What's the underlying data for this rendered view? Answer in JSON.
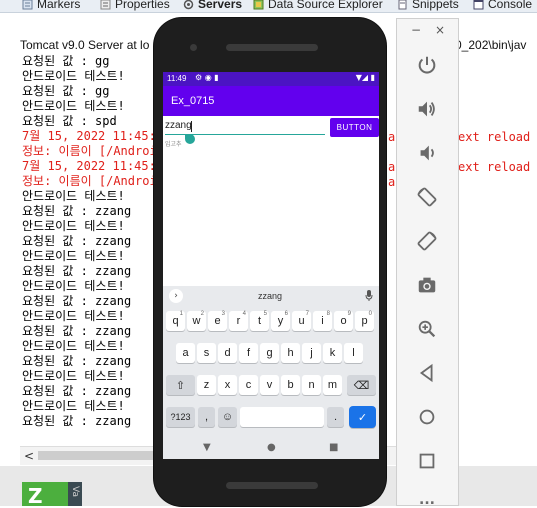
{
  "tabs": [
    {
      "label": "Markers",
      "icon": "markers-icon",
      "active": false
    },
    {
      "label": "Properties",
      "icon": "properties-icon",
      "active": false
    },
    {
      "label": "Servers",
      "icon": "servers-icon",
      "active": true
    },
    {
      "label": "Data Source Explorer",
      "icon": "data-source-icon",
      "active": false
    },
    {
      "label": "Snippets",
      "icon": "snippets-icon",
      "active": false
    },
    {
      "label": "Console",
      "icon": "console-icon",
      "active": false
    }
  ],
  "console": {
    "server_label": "Tomcat v9.0 Server at lo",
    "server_label_right": "0_202\\bin\\jav",
    "lines": [
      {
        "text": "요청된 값 : gg",
        "red": false
      },
      {
        "text": "안드로이드 테스트!",
        "red": false
      },
      {
        "text": "요청된 값 : gg",
        "red": false
      },
      {
        "text": "안드로이드 테스트!",
        "red": false
      },
      {
        "text": "요청된 값 : spd",
        "red": false
      },
      {
        "text": "7월 15, 2022 11:45:",
        "red": true
      },
      {
        "text": "정보: 이름이 [/Androi",
        "red": true
      },
      {
        "text": "7월 15, 2022 11:45:",
        "red": true
      },
      {
        "text": "정보: 이름이 [/Androi",
        "red": true
      },
      {
        "text": "안드로이드 테스트!",
        "red": false
      },
      {
        "text": "요청된 값 : zzang",
        "red": false
      },
      {
        "text": "안드로이드 테스트!",
        "red": false
      },
      {
        "text": "요청된 값 : zzang",
        "red": false
      },
      {
        "text": "안드로이드 테스트!",
        "red": false
      },
      {
        "text": "요청된 값 : zzang",
        "red": false
      },
      {
        "text": "안드로이드 테스트!",
        "red": false
      },
      {
        "text": "요청된 값 : zzang",
        "red": false
      },
      {
        "text": "안드로이드 테스트!",
        "red": false
      },
      {
        "text": "요청된 값 : zzang",
        "red": false
      },
      {
        "text": "안드로이드 테스트!",
        "red": false
      },
      {
        "text": "요청된 값 : zzang",
        "red": false
      },
      {
        "text": "안드로이드 테스트!",
        "red": false
      },
      {
        "text": "요청된 값 : zzang",
        "red": false
      },
      {
        "text": "안드로이드 테스트!",
        "red": false
      },
      {
        "text": "요청된 값 : zzang",
        "red": false
      }
    ],
    "red_fragments": [
      "a",
      "ext reload",
      "a",
      "ext reload",
      "a"
    ]
  },
  "phone": {
    "status_time": "11:49",
    "status_icons": "⚙ ◉ ▮",
    "status_right": "▼◢ ▮",
    "app_title": "Ex_0715",
    "input_value": "zzang",
    "hint_text": "입고추",
    "button_label": "BUTTON",
    "suggestion": "zzang",
    "keyboard": {
      "row1": [
        [
          "q",
          "1"
        ],
        [
          "w",
          "2"
        ],
        [
          "e",
          "3"
        ],
        [
          "r",
          "4"
        ],
        [
          "t",
          "5"
        ],
        [
          "y",
          "6"
        ],
        [
          "u",
          "7"
        ],
        [
          "i",
          "8"
        ],
        [
          "o",
          "9"
        ],
        [
          "p",
          "0"
        ]
      ],
      "row2": [
        "a",
        "s",
        "d",
        "f",
        "g",
        "h",
        "j",
        "k",
        "l"
      ],
      "row3": [
        "z",
        "x",
        "c",
        "v",
        "b",
        "n",
        "m"
      ],
      "symbols_key": "?123",
      "comma_key": ",",
      "emoji_key": "☺",
      "period_key": ".",
      "shift_key": "⇧",
      "delete_key": "⌫",
      "enter_key": "✓",
      "expand_key": "›",
      "mic_key": "🎤"
    },
    "nav": {
      "back": "▼",
      "home": "●",
      "recents": "■"
    }
  },
  "emulator": {
    "minimize": "−",
    "close": "×",
    "more": "..."
  },
  "taskbar": {
    "logo_text": "Z",
    "strip_text": "Va"
  },
  "colors": {
    "accent": "#6200ee",
    "status_bar": "#4b14c3",
    "console_error": "#e0211b",
    "underline": "#26a69a",
    "enter_key": "#1a73e8"
  }
}
